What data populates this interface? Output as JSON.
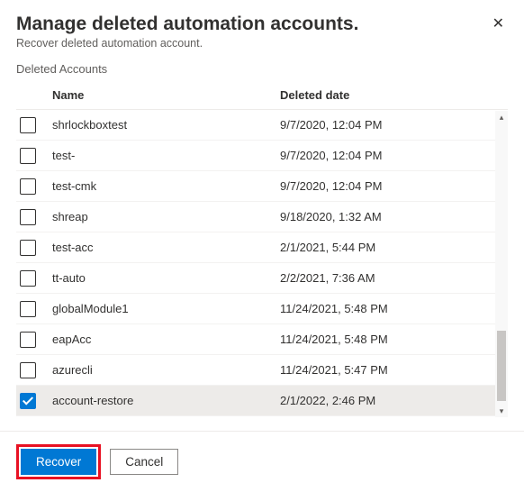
{
  "header": {
    "title": "Manage deleted automation accounts.",
    "subtitle": "Recover deleted automation account.",
    "close_icon": "✕"
  },
  "section_label": "Deleted Accounts",
  "columns": {
    "name": "Name",
    "date": "Deleted date"
  },
  "rows": [
    {
      "name": "shrlockboxtest",
      "date": "9/7/2020, 12:04 PM",
      "checked": false
    },
    {
      "name": "test-",
      "date": "9/7/2020, 12:04 PM",
      "checked": false
    },
    {
      "name": "test-cmk",
      "date": "9/7/2020, 12:04 PM",
      "checked": false
    },
    {
      "name": "shreap",
      "date": "9/18/2020, 1:32 AM",
      "checked": false
    },
    {
      "name": "test-acc",
      "date": "2/1/2021, 5:44 PM",
      "checked": false
    },
    {
      "name": "tt-auto",
      "date": "2/2/2021, 7:36 AM",
      "checked": false
    },
    {
      "name": "globalModule1",
      "date": "11/24/2021, 5:48 PM",
      "checked": false
    },
    {
      "name": "eapAcc",
      "date": "11/24/2021, 5:48 PM",
      "checked": false
    },
    {
      "name": "azurecli",
      "date": "11/24/2021, 5:47 PM",
      "checked": false
    },
    {
      "name": "account-restore",
      "date": "2/1/2022, 2:46 PM",
      "checked": true
    }
  ],
  "footer": {
    "recover": "Recover",
    "cancel": "Cancel"
  },
  "colors": {
    "primary": "#0078d4",
    "highlight": "#e81123"
  }
}
